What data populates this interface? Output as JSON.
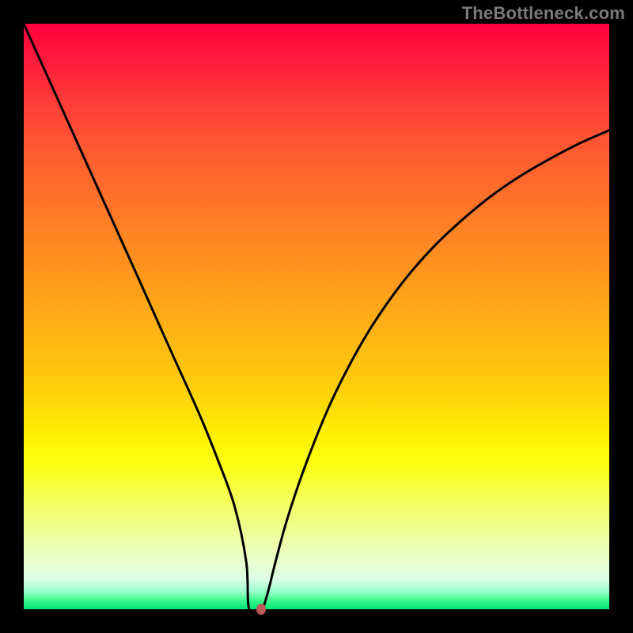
{
  "watermark": "TheBottleneck.com",
  "chart_data": {
    "type": "line",
    "title": "",
    "xlabel": "",
    "ylabel": "",
    "xlim": [
      0,
      100
    ],
    "ylim": [
      0,
      100
    ],
    "series": [
      {
        "name": "bottleneck-curve",
        "x": [
          0,
          5,
          10,
          15,
          20,
          25,
          30,
          33,
          36,
          38,
          38.5,
          40.5,
          41.5,
          43,
          45,
          48,
          52,
          56,
          60,
          65,
          70,
          75,
          80,
          85,
          90,
          95,
          100
        ],
        "y": [
          100,
          88.9,
          77.8,
          66.7,
          55.6,
          44.4,
          33.3,
          25.9,
          17.6,
          8.1,
          0,
          0,
          2.2,
          8.1,
          15.4,
          24.3,
          34.3,
          42.4,
          49.2,
          56.2,
          61.9,
          66.6,
          70.7,
          74.1,
          77.0,
          79.6,
          81.8
        ]
      }
    ],
    "marker": {
      "x": 40.5,
      "y": 0,
      "color": "#c05a5a"
    },
    "background_gradient": {
      "top": "#ff0240",
      "mid": "#ffe400",
      "bottom": "#00e676"
    },
    "frame_color": "#000000"
  }
}
